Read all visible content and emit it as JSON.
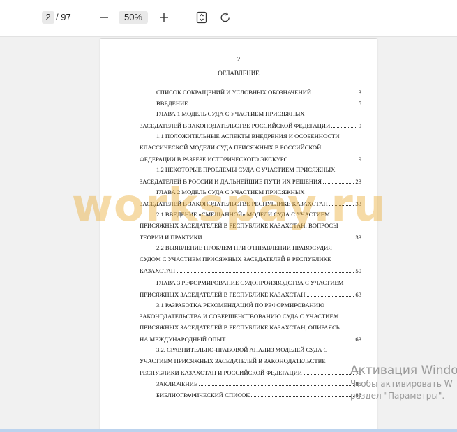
{
  "toolbar": {
    "page_current": "2",
    "page_total": "/ 97",
    "zoom": "50%",
    "icons": [
      "minus-icon",
      "plus-icon",
      "fit-page-icon",
      "rotate-icon"
    ]
  },
  "document": {
    "page_number": "2",
    "title": "ОГЛАВЛЕНИЕ",
    "toc": [
      {
        "text": "СПИСОК СОКРАЩЕНИЙ И УСЛОВНЫХ ОБОЗНАЧЕНИЙ",
        "page": "3"
      },
      {
        "text": "ВВЕДЕНИЕ",
        "page": "5"
      },
      {
        "text": "ГЛАВА 1 МОДЕЛЬ СУДА С УЧАСТИЕМ ПРИСЯЖНЫХ"
      },
      {
        "text": "ЗАСЕДАТЕЛЕЙ В ЗАКОНОДАТЕЛЬСТВЕ РОССИЙСКОЙ ФЕДЕРАЦИИ",
        "page": "9"
      },
      {
        "text": "1.1 ПОЛОЖИТЕЛЬНЫЕ АСПЕКТЫ ВНЕДРЕНИЯ И ОСОБЕННОСТИ"
      },
      {
        "text": "КЛАССИЧЕСКОЙ МОДЕЛИ СУДА ПРИСЯЖНЫХ В РОССИЙСКОЙ"
      },
      {
        "text": "ФЕДЕРАЦИИ В РАЗРЕЗЕ ИСТОРИЧЕСКОГО ЭКСКУРС",
        "page": "9"
      },
      {
        "text": "1.2 НЕКОТОРЫЕ ПРОБЛЕМЫ СУДА С УЧАСТИЕМ ПРИСЯЖНЫХ"
      },
      {
        "text": "ЗАСЕДАТЕЛЕЙ В РОССИИ И ДАЛЬНЕЙШИЕ ПУТИ ИХ РЕШЕНИЯ",
        "page": "23"
      },
      {
        "text": "ГЛАВА 2 МОДЕЛЬ СУДА С УЧАСТИЕМ ПРИСЯЖНЫХ"
      },
      {
        "text": "ЗАСЕДАТЕЛЕЙ В ЗАКОНОДАТЕЛЬСТВЕ РЕСПУБЛИКЕ КАЗАХСТАН",
        "page": "33"
      },
      {
        "text": "2.1 ВВЕДЕНИЕ «СМЕШАННОЙ» МОДЕЛИ СУДА С УЧАСТИЕМ"
      },
      {
        "text": "ПРИСЯЖНЫХ ЗАСЕДАТЕЛЕЙ В РЕСПУБЛИКЕ КАЗАХСТАН: ВОПРОСЫ"
      },
      {
        "text": "ТЕОРИИ И ПРАКТИКИ",
        "page": "33"
      },
      {
        "text": "2.2 ВЫЯВЛЕНИЕ ПРОБЛЕМ ПРИ ОТПРАВЛЕНИИ ПРАВОСУДИЯ"
      },
      {
        "text": "СУДОМ С УЧАСТИЕМ ПРИСЯЖНЫХ ЗАСЕДАТЕЛЕЙ В РЕСПУБЛИКЕ"
      },
      {
        "text": "КАЗАХСТАН",
        "page": "50"
      },
      {
        "text": "ГЛАВА 3 РЕФОРМИРОВАНИЕ СУДОПРОИЗВОДСТВА С УЧАСТИЕМ"
      },
      {
        "text": "ПРИСЯЖНЫХ ЗАСЕДАТЕЛЕЙ В РЕСПУБЛИКЕ КАЗАХСТАН",
        "page": "63"
      },
      {
        "text": "3.1 РАЗРАБОТКА РЕКОМЕНДАЦИЙ ПО РЕФОРМИРОВАНИЮ"
      },
      {
        "text": "ЗАКОНОДАТЕЛЬСТВА И СОВЕРШЕНСТВОВАНИЮ СУДА С УЧАСТИЕМ"
      },
      {
        "text": "ПРИСЯЖНЫХ ЗАСЕДАТЕЛЕЙ В РЕСПУБЛИКЕ КАЗАХСТАН, ОПИРАЯСЬ"
      },
      {
        "text": "НА МЕЖДУНАРОДНЫЙ ОПЫТ",
        "page": "63"
      },
      {
        "text": "3.2. СРАВНИТЕЛЬНО-ПРАВОВОЙ АНАЛИЗ МОДЕЛЕЙ СУДА С"
      },
      {
        "text": "УЧАСТИЕМ ПРИСЯЖНЫХ ЗАСЕДАТЕЛЕЙ В ЗАКОНОДАТЕЛЬСТВЕ"
      },
      {
        "text": "РЕСПУБЛИКИ КАЗАХСТАН И РОССИЙСКОЙ ФЕДЕРАЦИИ",
        "page": "76"
      },
      {
        "text": "ЗАКЛЮЧЕНИЕ",
        "page": "85"
      },
      {
        "text": "БИБЛИОГРАФИЧЕСКИЙ СПИСОК",
        "page": "88"
      }
    ]
  },
  "watermark": "workspay.ru",
  "activation": {
    "title": "Активация Windo",
    "line1": "Чтобы активировать W",
    "line2": "раздел \"Параметры\"."
  },
  "colors": {
    "watermark": "#ecaf3c",
    "accent_bar": "#bcd3ee"
  }
}
